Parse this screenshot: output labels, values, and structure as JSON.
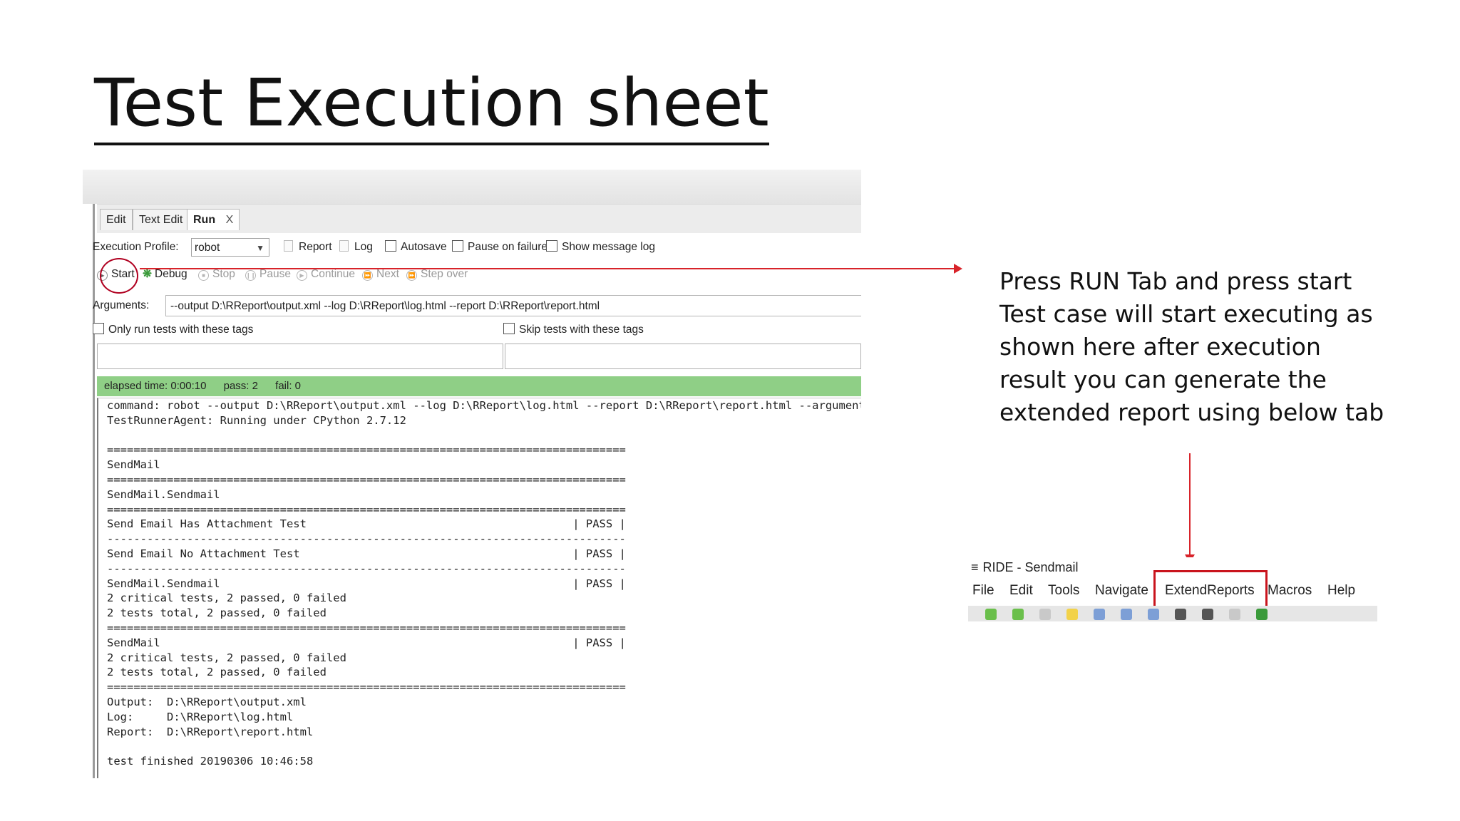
{
  "slide": {
    "title": "Test Execution sheet",
    "instructions": [
      "Press RUN Tab and press start",
      "Test case will start executing as",
      "shown here after execution",
      "result you can generate the",
      "extended report using below tab"
    ]
  },
  "run_panel": {
    "tabs": [
      {
        "label": "Edit"
      },
      {
        "label": "Text Edit"
      },
      {
        "label": "Run",
        "close": "X"
      }
    ],
    "execution_profile_label": "Execution Profile:",
    "execution_profile_value": "robot",
    "report_label": "Report",
    "log_label": "Log",
    "autosave_label": "Autosave",
    "pause_on_failure_label": "Pause on failure",
    "show_message_log_label": "Show message log",
    "buttons": {
      "start": "Start",
      "debug": "Debug",
      "stop": "Stop",
      "pause": "Pause",
      "continue": "Continue",
      "next": "Next",
      "step_over": "Step over"
    },
    "arguments_label": "Arguments:",
    "arguments_value": "--output D:\\RReport\\output.xml  --log  D:\\RReport\\log.html  --report D:\\RReport\\report.html",
    "only_run_tags_label": "Only run tests with these tags",
    "skip_tags_label": "Skip tests with these tags",
    "status": {
      "elapsed": "elapsed time: 0:00:10",
      "pass": "pass: 2",
      "fail": "fail: 0"
    },
    "console_lines": [
      "command: robot --output D:\\RReport\\output.xml --log D:\\RReport\\log.html --report D:\\RReport\\report.html --argumentf",
      "TestRunnerAgent: Running under CPython 2.7.12",
      "",
      "==============================================================================",
      "SendMail",
      "==============================================================================",
      "SendMail.Sendmail",
      "==============================================================================",
      "Send Email Has Attachment Test                                        | PASS |",
      "------------------------------------------------------------------------------",
      "Send Email No Attachment Test                                         | PASS |",
      "------------------------------------------------------------------------------",
      "SendMail.Sendmail                                                     | PASS |",
      "2 critical tests, 2 passed, 0 failed",
      "2 tests total, 2 passed, 0 failed",
      "==============================================================================",
      "SendMail                                                              | PASS |",
      "2 critical tests, 2 passed, 0 failed",
      "2 tests total, 2 passed, 0 failed",
      "==============================================================================",
      "Output:  D:\\RReport\\output.xml",
      "Log:     D:\\RReport\\log.html",
      "Report:  D:\\RReport\\report.html",
      "",
      "test finished 20190306 10:46:58"
    ]
  },
  "ride_menu": {
    "window_title": "RIDE - Sendmail",
    "menus": [
      "File",
      "Edit",
      "Tools",
      "Navigate",
      "ExtendReports",
      "Macros",
      "Help"
    ]
  },
  "colors": {
    "annotation_red": "#d8232a",
    "status_green": "#8fcf86"
  }
}
